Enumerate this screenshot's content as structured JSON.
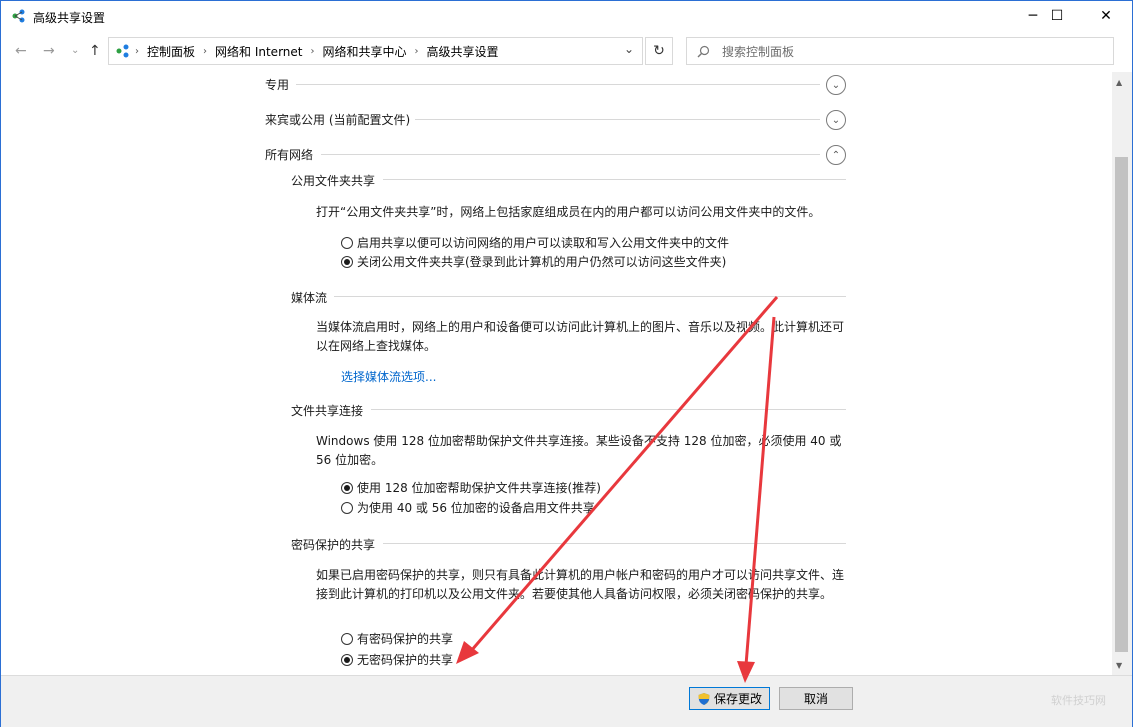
{
  "window": {
    "title": "高级共享设置"
  },
  "titlebar": {
    "minimize": "─",
    "maximize": "☐",
    "close": "✕"
  },
  "nav": {
    "back": "←",
    "forward": "→",
    "dropdown": "⌄",
    "up": "↑"
  },
  "breadcrumb": {
    "items": [
      "控制面板",
      "网络和 Internet",
      "网络和共享中心",
      "高级共享设置"
    ],
    "separator": "›",
    "dropdown": "⌄"
  },
  "refresh": "↻",
  "search": {
    "placeholder": "搜索控制面板"
  },
  "profiles": [
    {
      "label": "专用",
      "state": "collapsed",
      "glyph": "⌄"
    },
    {
      "label": "来宾或公用 (当前配置文件)",
      "state": "collapsed",
      "glyph": "⌄"
    },
    {
      "label": "所有网络",
      "state": "expanded",
      "glyph": "⌃"
    }
  ],
  "public_folder": {
    "title": "公用文件夹共享",
    "desc": "打开“公用文件夹共享”时，网络上包括家庭组成员在内的用户都可以访问公用文件夹中的文件。",
    "options": [
      {
        "label": "启用共享以便可以访问网络的用户可以读取和写入公用文件夹中的文件",
        "checked": false
      },
      {
        "label": "关闭公用文件夹共享(登录到此计算机的用户仍然可以访问这些文件夹)",
        "checked": true
      }
    ]
  },
  "media": {
    "title": "媒体流",
    "desc": "当媒体流启用时，网络上的用户和设备便可以访问此计算机上的图片、音乐以及视频。此计算机还可以在网络上查找媒体。",
    "link": "选择媒体流选项..."
  },
  "file_sharing": {
    "title": "文件共享连接",
    "desc": "Windows 使用 128 位加密帮助保护文件共享连接。某些设备不支持 128 位加密，必须使用 40 或 56 位加密。",
    "options": [
      {
        "label": "使用 128 位加密帮助保护文件共享连接(推荐)",
        "checked": true
      },
      {
        "label": "为使用 40 或 56 位加密的设备启用文件共享",
        "checked": false
      }
    ]
  },
  "password": {
    "title": "密码保护的共享",
    "desc": "如果已启用密码保护的共享，则只有具备此计算机的用户帐户和密码的用户才可以访问共享文件、连接到此计算机的打印机以及公用文件夹。若要使其他人具备访问权限，必须关闭密码保护的共享。",
    "options": [
      {
        "label": "有密码保护的共享",
        "checked": false
      },
      {
        "label": "无密码保护的共享",
        "checked": true
      }
    ]
  },
  "footer": {
    "save": "保存更改",
    "cancel": "取消"
  },
  "scrollbar": {
    "up": "▲",
    "down": "▼"
  },
  "watermark": "软件技巧网",
  "colors": {
    "accent": "#0078d7",
    "link": "#0066cc",
    "annotation": "#e8383d"
  }
}
